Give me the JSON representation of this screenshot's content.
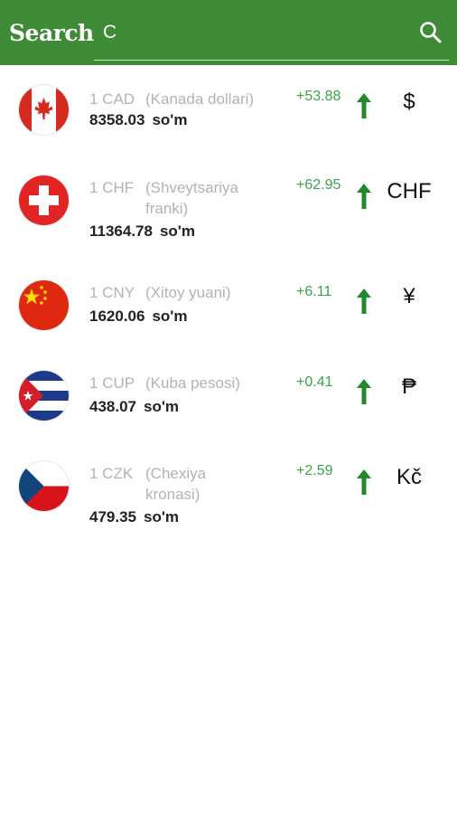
{
  "header": {
    "title": "Search",
    "query": "C"
  },
  "colors": {
    "header_bg": "#3f8a36",
    "positive": "#3aa34a",
    "arrow": "#1f8a2a"
  },
  "rows": [
    {
      "flag": "canada-flag",
      "code": "1 CAD",
      "name": "(Kanada dollari)",
      "rate": "8358.03",
      "unit": "so'm",
      "change": "+53.88",
      "trend": "up-arrow-icon",
      "symbol": "$"
    },
    {
      "flag": "switzerland-flag",
      "code": "1 CHF",
      "name": "(Shveytsariya franki)",
      "rate": "11364.78",
      "unit": "so'm",
      "change": "+62.95",
      "trend": "up-arrow-icon",
      "symbol": "CHF"
    },
    {
      "flag": "china-flag",
      "code": "1 CNY",
      "name": "(Xitoy yuani)",
      "rate": "1620.06",
      "unit": "so'm",
      "change": "+6.11",
      "trend": "up-arrow-icon",
      "symbol": "¥"
    },
    {
      "flag": "cuba-flag",
      "code": "1 CUP",
      "name": "(Kuba pesosi)",
      "rate": "438.07",
      "unit": "so'm",
      "change": "+0.41",
      "trend": "up-arrow-icon",
      "symbol": "₱"
    },
    {
      "flag": "czech-flag",
      "code": "1 CZK",
      "name": "(Chexiya kronasi)",
      "rate": "479.35",
      "unit": "so'm",
      "change": "+2.59",
      "trend": "up-arrow-icon",
      "symbol": "Kč"
    }
  ]
}
